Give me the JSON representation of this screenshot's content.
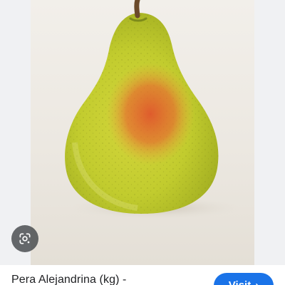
{
  "result": {
    "title": "Pera Alejandrina (kg) -",
    "visit_label": "Visit",
    "visit_chevron": "›"
  },
  "image": {
    "subject": "pear-photo"
  },
  "icons": {
    "lens": "google-lens-icon",
    "chevron": "chevron-right-icon"
  },
  "colors": {
    "visit_button": "#1a73e8",
    "lens_button": "#3c4043",
    "title_text": "#202124"
  }
}
